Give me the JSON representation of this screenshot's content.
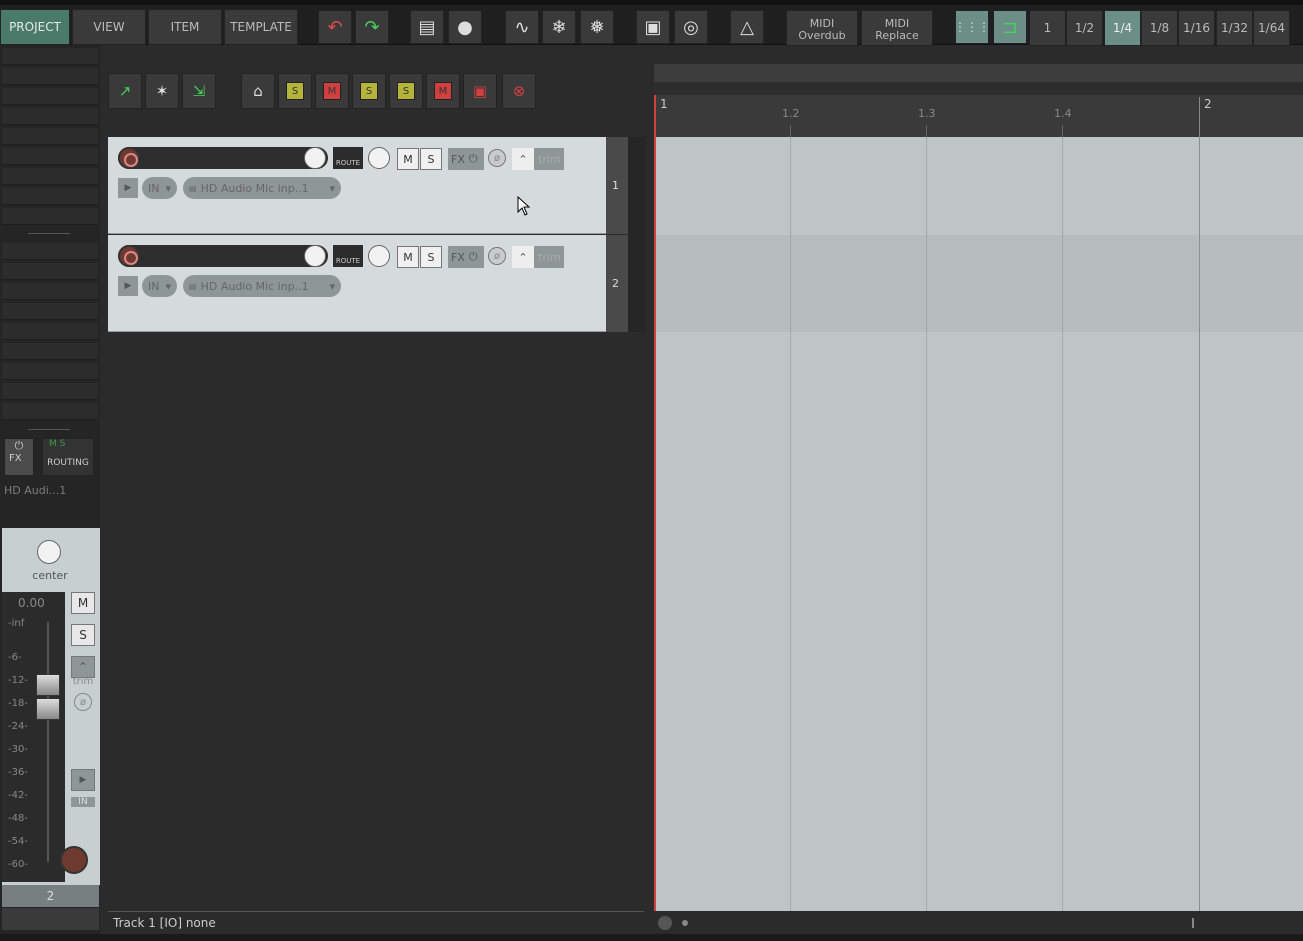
{
  "toolbar": {
    "tabs": [
      "PROJECT",
      "VIEW",
      "ITEM",
      "TEMPLATE"
    ],
    "midi_overdub": [
      "MIDI",
      "Overdub"
    ],
    "midi_replace": [
      "MIDI",
      "Replace"
    ],
    "grid_divisions": [
      "1",
      "1/2",
      "1/4",
      "1/8",
      "1/16",
      "1/32",
      "1/64"
    ],
    "selected_grid": "1/4"
  },
  "left_panel": {
    "fx_label": "FX",
    "routing_label": "ROUTING",
    "input_label": "HD Audi...1"
  },
  "mixer": {
    "pan_label": "center",
    "volume_readout": "0.00",
    "scale_labels": [
      "-inf",
      "-6-",
      "-12-",
      "-18-",
      "-24-",
      "-30-",
      "-36-",
      "-42-",
      "-48-",
      "-54-",
      "-60-"
    ],
    "mute_label": "M",
    "solo_label": "S",
    "trim_label": "trim",
    "in_label": "IN",
    "track_number": "2"
  },
  "tracks": [
    {
      "number": "1",
      "route_label": "ROUTE",
      "mute_label": "M",
      "solo_label": "S",
      "fx_label": "FX",
      "trim_label": "trim",
      "in_label": "IN",
      "input": "HD Audio Mic inp..1"
    },
    {
      "number": "2",
      "route_label": "ROUTE",
      "mute_label": "M",
      "solo_label": "S",
      "fx_label": "FX",
      "trim_label": "trim",
      "in_label": "IN",
      "input": "HD Audio Mic inp..1"
    }
  ],
  "ruler": {
    "labels": [
      "1",
      "1.2",
      "1.3",
      "1.4",
      "2"
    ]
  },
  "status": {
    "text": "Track 1 [IO] none"
  }
}
